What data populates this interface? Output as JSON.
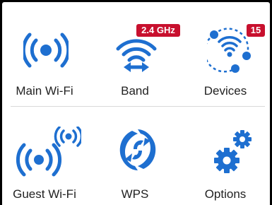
{
  "colors": {
    "accent": "#1e6fd0",
    "badge": "#c8102e"
  },
  "tiles": [
    {
      "id": "main-wifi",
      "label": "Main Wi-Fi",
      "icon": "broadcast-icon"
    },
    {
      "id": "band",
      "label": "Band",
      "icon": "wifi-band-icon",
      "badge": "2.4 GHz"
    },
    {
      "id": "devices",
      "label": "Devices",
      "icon": "devices-network-icon",
      "badge": "15"
    },
    {
      "id": "guest-wifi",
      "label": "Guest Wi-Fi",
      "icon": "guest-broadcast-icon"
    },
    {
      "id": "wps",
      "label": "WPS",
      "icon": "wps-icon"
    },
    {
      "id": "options",
      "label": "Options",
      "icon": "gears-icon"
    }
  ]
}
